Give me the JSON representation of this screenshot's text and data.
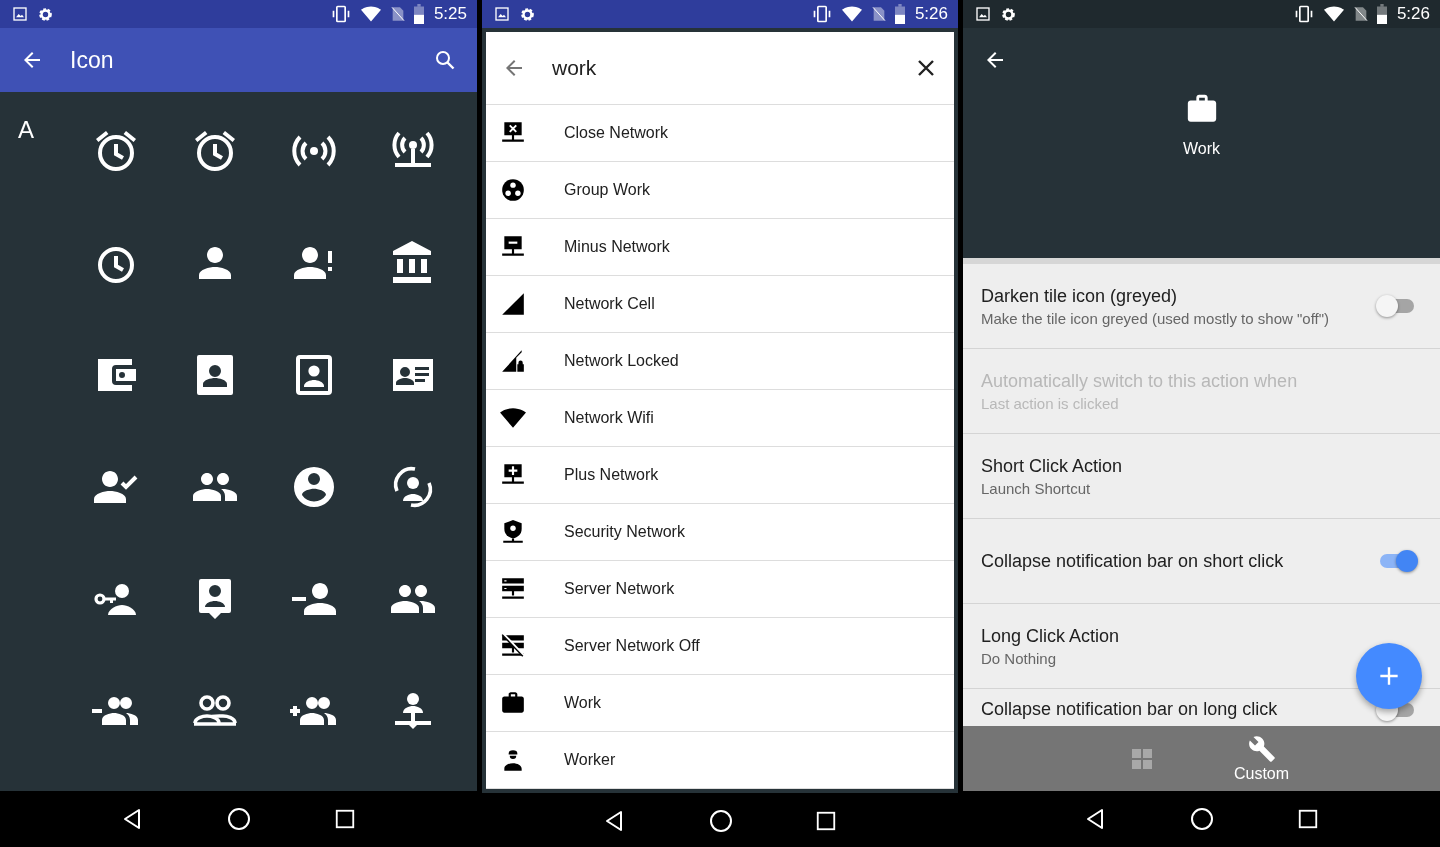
{
  "screens": [
    {
      "status_bar": {
        "time": "5:25"
      },
      "toolbar": {
        "title": "Icon"
      },
      "section_letter": "A"
    },
    {
      "status_bar": {
        "time": "5:26"
      },
      "search": {
        "query": "work"
      },
      "results": [
        {
          "label": "Close Network"
        },
        {
          "label": "Group Work"
        },
        {
          "label": "Minus Network"
        },
        {
          "label": "Network Cell"
        },
        {
          "label": "Network Locked"
        },
        {
          "label": "Network Wifi"
        },
        {
          "label": "Plus Network"
        },
        {
          "label": "Security Network"
        },
        {
          "label": "Server Network"
        },
        {
          "label": "Server Network Off"
        },
        {
          "label": "Work"
        },
        {
          "label": "Worker"
        }
      ]
    },
    {
      "status_bar": {
        "time": "5:26"
      },
      "header": {
        "title": "Work"
      },
      "settings": [
        {
          "kind": "switch",
          "title": "Darken tile icon (greyed)",
          "subtitle": "Make the tile icon greyed (used mostly to show \"off\")",
          "on": false,
          "disabled": false
        },
        {
          "kind": "text",
          "title": "Automatically switch to this action when",
          "subtitle": "Last action is clicked",
          "disabled": true
        },
        {
          "kind": "text",
          "title": "Short Click Action",
          "subtitle": "Launch Shortcut",
          "disabled": false
        },
        {
          "kind": "switch",
          "title": "Collapse notification bar on short click",
          "on": true,
          "disabled": false
        },
        {
          "kind": "text",
          "title": "Long Click Action",
          "subtitle": "Do Nothing",
          "disabled": false
        },
        {
          "kind": "switch",
          "title": "Collapse notification bar on long click",
          "on": false,
          "disabled": false
        }
      ],
      "bottom_nav": [
        {
          "kind": "grid",
          "selected": false
        },
        {
          "kind": "wrench",
          "label": "Custom",
          "selected": true
        }
      ]
    }
  ]
}
